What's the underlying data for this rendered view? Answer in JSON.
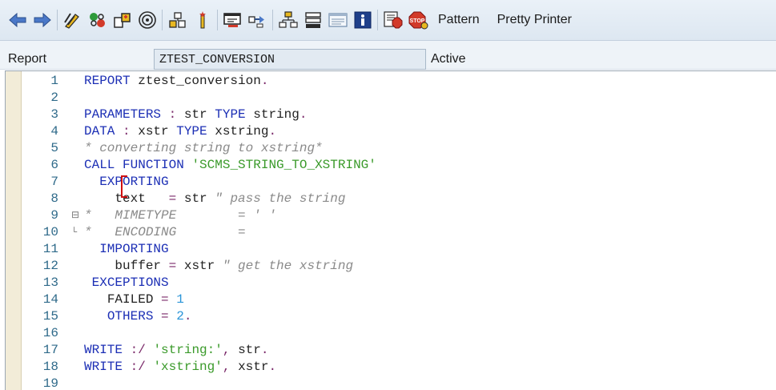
{
  "toolbar": {
    "pattern_label": "Pattern",
    "pretty_printer_label": "Pretty Printer",
    "colors": {
      "arrow": "#4a78c8",
      "red": "#d23a2a",
      "green": "#2e9a3a",
      "yellow": "#e8b820",
      "dark": "#2a2a2a"
    }
  },
  "header": {
    "report_label": "Report",
    "program_name": "ZTEST_CONVERSION",
    "status": "Active"
  },
  "editor": {
    "lines": [
      {
        "n": "1",
        "fold": "",
        "indent": "",
        "tokens": [
          [
            "k",
            "REPORT"
          ],
          [
            "p",
            " ztest_conversion"
          ],
          [
            "o",
            "."
          ]
        ]
      },
      {
        "n": "2",
        "fold": "",
        "indent": "",
        "tokens": []
      },
      {
        "n": "3",
        "fold": "",
        "indent": "",
        "tokens": [
          [
            "k",
            "PARAMETERS"
          ],
          [
            "o",
            " :"
          ],
          [
            "p",
            " str "
          ],
          [
            "k",
            "TYPE"
          ],
          [
            "p",
            " string"
          ],
          [
            "o",
            "."
          ]
        ]
      },
      {
        "n": "4",
        "fold": "",
        "indent": "",
        "tokens": [
          [
            "k",
            "DATA"
          ],
          [
            "o",
            " :"
          ],
          [
            "p",
            " xstr "
          ],
          [
            "k",
            "TYPE"
          ],
          [
            "p",
            " xstring"
          ],
          [
            "o",
            "."
          ]
        ]
      },
      {
        "n": "5",
        "fold": "",
        "indent": "",
        "tokens": [
          [
            "c",
            "* converting string to xstring*"
          ]
        ]
      },
      {
        "n": "6",
        "fold": "",
        "indent": "",
        "tokens": [
          [
            "k",
            "CALL FUNCTION"
          ],
          [
            "p",
            " "
          ],
          [
            "s",
            "'SCMS_STRING_TO_XSTRING'"
          ]
        ]
      },
      {
        "n": "7",
        "fold": "",
        "indent": "  ",
        "tokens": [
          [
            "k",
            "EXPORTING"
          ]
        ]
      },
      {
        "n": "8",
        "fold": "",
        "indent": "    ",
        "tokens": [
          [
            "p",
            "text   "
          ],
          [
            "o",
            "="
          ],
          [
            "p",
            " str "
          ],
          [
            "c",
            "\" pass the string"
          ]
        ]
      },
      {
        "n": "9",
        "fold": "⊟",
        "indent": "",
        "tokens": [
          [
            "c",
            "*   MIMETYPE        = ' '"
          ]
        ]
      },
      {
        "n": "10",
        "fold": "└",
        "indent": "",
        "tokens": [
          [
            "c",
            "*   ENCODING        ="
          ]
        ]
      },
      {
        "n": "11",
        "fold": "",
        "indent": "  ",
        "tokens": [
          [
            "k",
            "IMPORTING"
          ]
        ]
      },
      {
        "n": "12",
        "fold": "",
        "indent": "    ",
        "tokens": [
          [
            "p",
            "buffer "
          ],
          [
            "o",
            "="
          ],
          [
            "p",
            " xstr "
          ],
          [
            "c",
            "\" get the xstring"
          ]
        ]
      },
      {
        "n": "13",
        "fold": "",
        "indent": " ",
        "tokens": [
          [
            "k",
            "EXCEPTIONS"
          ]
        ]
      },
      {
        "n": "14",
        "fold": "",
        "indent": "   ",
        "tokens": [
          [
            "p",
            "FAILED "
          ],
          [
            "o",
            "="
          ],
          [
            "p",
            " "
          ],
          [
            "n",
            "1"
          ]
        ]
      },
      {
        "n": "15",
        "fold": "",
        "indent": "   ",
        "tokens": [
          [
            "k",
            "OTHERS"
          ],
          [
            "p",
            " "
          ],
          [
            "o",
            "="
          ],
          [
            "p",
            " "
          ],
          [
            "n",
            "2"
          ],
          [
            "o",
            "."
          ]
        ]
      },
      {
        "n": "16",
        "fold": "",
        "indent": "",
        "tokens": []
      },
      {
        "n": "17",
        "fold": "",
        "indent": "",
        "tokens": [
          [
            "k",
            "WRITE"
          ],
          [
            "o",
            " :/"
          ],
          [
            "p",
            " "
          ],
          [
            "s",
            "'string:'"
          ],
          [
            "o",
            ","
          ],
          [
            "p",
            " str"
          ],
          [
            "o",
            "."
          ]
        ]
      },
      {
        "n": "18",
        "fold": "",
        "indent": "",
        "tokens": [
          [
            "k",
            "WRITE"
          ],
          [
            "o",
            " :/"
          ],
          [
            "p",
            " "
          ],
          [
            "s",
            "'xstring'"
          ],
          [
            "o",
            ","
          ],
          [
            "p",
            " xstr"
          ],
          [
            "o",
            "."
          ]
        ]
      },
      {
        "n": "19",
        "fold": "",
        "indent": "",
        "tokens": []
      }
    ]
  }
}
